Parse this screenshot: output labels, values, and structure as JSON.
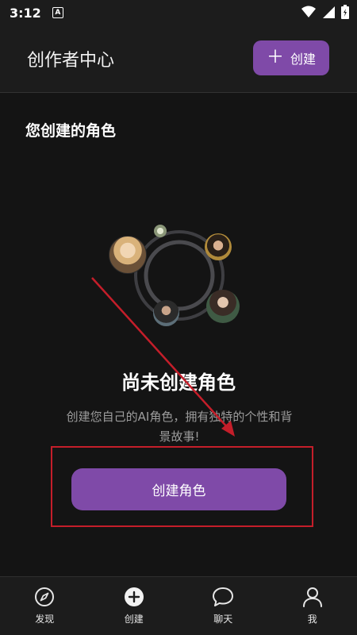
{
  "status_bar": {
    "time": "3:12",
    "notification_icon": "A",
    "icons": [
      "wifi-icon",
      "signal-icon",
      "battery-icon"
    ]
  },
  "header": {
    "title": "创作者中心",
    "create_label": "创建",
    "create_icon": "plus-icon"
  },
  "section": {
    "title": "您创建的角色"
  },
  "empty_state": {
    "title": "尚未创建角色",
    "description_line1": "创建您自己的AI角色，拥有独特的个性和背",
    "description_line2": "景故事!",
    "button_label": "创建角色"
  },
  "bottom_nav": {
    "items": [
      {
        "label": "发现",
        "icon": "compass-icon"
      },
      {
        "label": "创建",
        "icon": "add-circle-icon"
      },
      {
        "label": "聊天",
        "icon": "chat-bubble-icon"
      },
      {
        "label": "我",
        "icon": "person-icon"
      }
    ]
  },
  "colors": {
    "accent": "#7f4aa8",
    "background": "#141414",
    "surface": "#1c1c1c",
    "annotation_red": "#c41e2a"
  }
}
